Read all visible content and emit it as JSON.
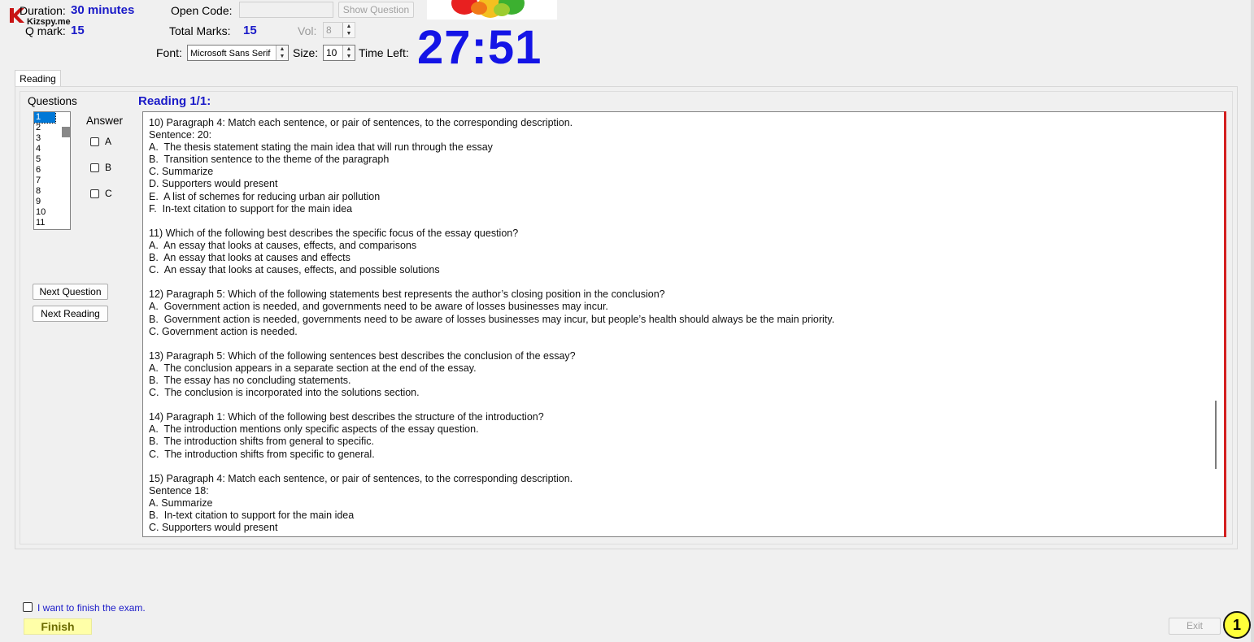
{
  "header": {
    "logo_text": "Kizspy.me",
    "duration_label": "Duration:",
    "duration_value": "30 minutes",
    "qmark_label": "Q mark:",
    "qmark_value": "15",
    "open_code_label": "Open Code:",
    "open_code_value": "",
    "show_question_label": "Show Question",
    "total_marks_label": "Total Marks:",
    "total_marks_value": "15",
    "vol_label": "Vol:",
    "vol_value": "8",
    "font_label": "Font:",
    "font_value": "Microsoft Sans Serif",
    "size_label": "Size:",
    "size_value": "10",
    "time_left_label": "Time Left:",
    "time_left_value": "27:51"
  },
  "tabs": [
    {
      "label": "Reading",
      "active": true
    }
  ],
  "questions_panel": {
    "title": "Questions",
    "items": [
      "1",
      "2",
      "3",
      "4",
      "5",
      "6",
      "7",
      "8",
      "9",
      "10",
      "11"
    ],
    "selected": "1"
  },
  "answer_panel": {
    "title": "Answer",
    "options": [
      "A",
      "B",
      "C"
    ]
  },
  "buttons": {
    "next_question": "Next Question",
    "next_reading": "Next Reading"
  },
  "reading": {
    "title": "Reading 1/1:",
    "lines": [
      "10) Paragraph 4: Match each sentence, or pair of sentences, to the corresponding description.",
      "Sentence: 20:",
      "A.  The thesis statement stating the main idea that will run through the essay",
      "B.  Transition sentence to the theme of the paragraph",
      "C. Summarize",
      "D. Supporters would present",
      "E.  A list of schemes for reducing urban air pollution",
      "F.  In-text citation to support for the main idea",
      "",
      "11) Which of the following best describes the specific focus of the essay question?",
      "A.  An essay that looks at causes, effects, and comparisons",
      "B.  An essay that looks at causes and effects",
      "C.  An essay that looks at causes, effects, and possible solutions",
      "",
      "12) Paragraph 5: Which of the following statements best represents the author’s closing position in the conclusion?",
      "A.  Government action is needed, and governments need to be aware of losses businesses may incur.",
      "B.  Government action is needed, governments need to be aware of losses businesses may incur, but people’s health should always be the main priority.",
      "C. Government action is needed.",
      "",
      "13) Paragraph 5: Which of the following sentences best describes the conclusion of the essay?",
      "A.  The conclusion appears in a separate section at the end of the essay.",
      "B.  The essay has no concluding statements.",
      "C.  The conclusion is incorporated into the solutions section.",
      "",
      "14) Paragraph 1: Which of the following best describes the structure of the introduction?",
      "A.  The introduction mentions only specific aspects of the essay question.",
      "B.  The introduction shifts from general to specific.",
      "C.  The introduction shifts from specific to general.",
      "",
      "15) Paragraph 4: Match each sentence, or pair of sentences, to the corresponding description.",
      "Sentence 18:",
      "A. Summarize",
      "B.  In-text citation to support for the main idea",
      "C. Supporters would present"
    ]
  },
  "footer": {
    "finish_checkbox_label": "I want to finish the exam.",
    "finish_button": "Finish",
    "exit_button": "Exit",
    "badge": "1"
  },
  "colors": {
    "accent_blue": "#1a1ac8",
    "timer_blue": "#1414e6",
    "finish_yellow": "#ffffa8",
    "badge_yellow": "#ffff3a",
    "scroll_red": "#d42020"
  }
}
